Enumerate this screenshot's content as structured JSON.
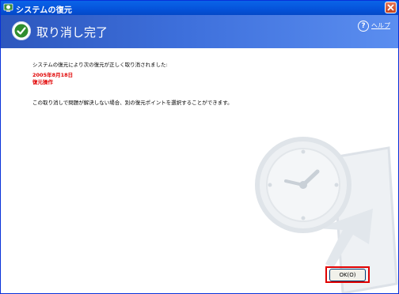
{
  "window": {
    "title": "システムの復元",
    "close_icon": "close-icon",
    "app_icon": "system-restore-icon"
  },
  "banner": {
    "heading": "取り消し完了",
    "help_label": "ヘルプ",
    "help_icon": "help-icon",
    "status_icon": "checkmark-icon"
  },
  "content": {
    "message1": "システムの復元により次の復元が正しく取り消されました:",
    "date": "2005年8月18日",
    "operation": "復元操作",
    "message2": "この取り消しで問題が解決しない場合、別の復元ポイントを選択することができます。"
  },
  "footer": {
    "ok_label": "OK(O)"
  },
  "colors": {
    "banner_start": "#2d57bd",
    "banner_end": "#5b8ef0",
    "highlight": "#e00000",
    "accent_text": "#e00000"
  }
}
